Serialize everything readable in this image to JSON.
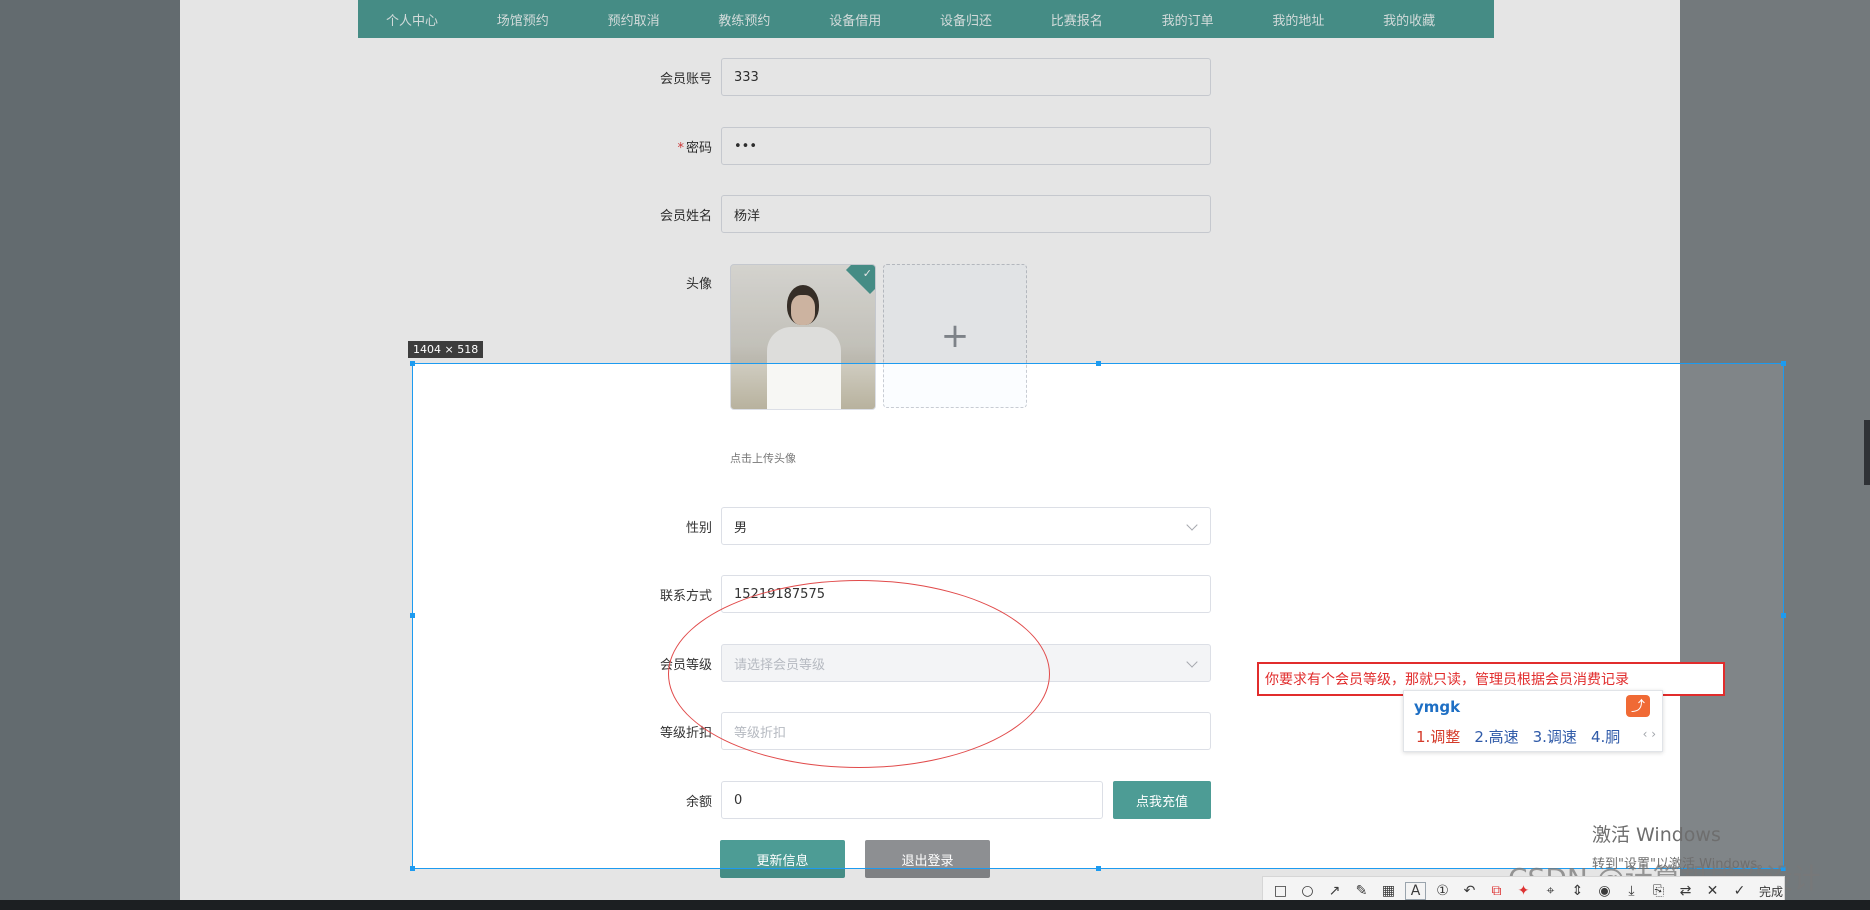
{
  "nav": {
    "items": [
      "个人中心",
      "场馆预约",
      "预约取消",
      "教练预约",
      "设备借用",
      "设备归还",
      "比赛报名",
      "我的订单",
      "我的地址",
      "我的收藏"
    ]
  },
  "form": {
    "account": {
      "label": "会员账号",
      "value": "333"
    },
    "password": {
      "required_mark": "*",
      "label": "密码",
      "value": "•••"
    },
    "name": {
      "label": "会员姓名",
      "value": "杨洋"
    },
    "avatar": {
      "label": "头像",
      "upload_plus": "+",
      "upload_tip": "点击上传头像"
    },
    "gender": {
      "label": "性别",
      "value": "男"
    },
    "phone": {
      "label": "联系方式",
      "value": "15219187575"
    },
    "level": {
      "label": "会员等级",
      "placeholder": "请选择会员等级"
    },
    "discount": {
      "label": "等级折扣",
      "placeholder": "等级折扣"
    },
    "balance": {
      "label": "余额",
      "value": "0",
      "recharge_button": "点我充值"
    },
    "update_button": "更新信息",
    "logout_button": "退出登录"
  },
  "overlay": {
    "size_label": "1404 × 518",
    "annotation_text": "你要求有个会员等级，那就只读，管理员根据会员消费记录",
    "ime": {
      "input": "ymgk",
      "candidates": [
        "1.调整",
        "2.高速",
        "3.调速",
        "4.胴"
      ],
      "arrows": "‹ ›"
    },
    "toolbar_done": "完成",
    "windows_watermark": {
      "title": "激活 Windows",
      "subtitle": "转到\"设置\"以激活 Windows。"
    },
    "csdn_watermark": "CSDN @计算机毕设设计"
  },
  "colors": {
    "brand": "#4d9c95",
    "logout": "#8d8f92",
    "annotation": "#e12c2c",
    "selection": "#1d9bf0"
  },
  "icons": {
    "toolbar": [
      "rectangle-icon",
      "ellipse-icon",
      "arrow-icon",
      "pen-icon",
      "mosaic-icon",
      "text-icon",
      "number-icon",
      "undo-icon",
      "ocr-icon",
      "ai-icon",
      "pin-icon",
      "scroll-capture-icon",
      "record-icon",
      "save-icon",
      "copy-icon",
      "translate-icon",
      "close-icon",
      "check-icon"
    ]
  }
}
